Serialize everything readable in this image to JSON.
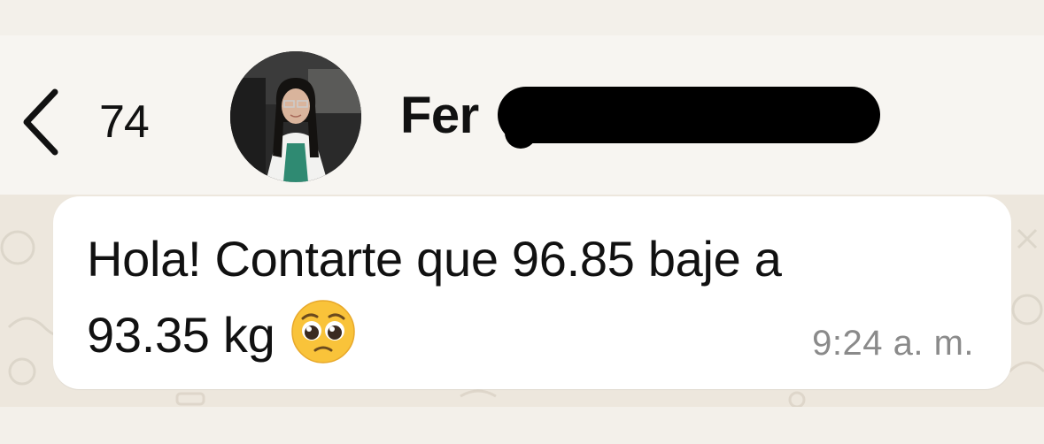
{
  "header": {
    "back_icon": "chevron-left-icon",
    "unread_count": "74",
    "contact_name": "Fer",
    "name_redacted": true,
    "avatar_icon": "profile-photo"
  },
  "message": {
    "line1": "Hola! Contarte que 96.85 baje a",
    "line2": "93.35 kg",
    "emoji": "pleading-face-emoji",
    "time": "9:24",
    "meridiem": "a. m."
  },
  "colors": {
    "background": "#f3f0ea",
    "bubble": "#ffffff",
    "text": "#111111",
    "timestamp": "#8a8a8a",
    "chat_wallpaper": "#ede7dd"
  }
}
